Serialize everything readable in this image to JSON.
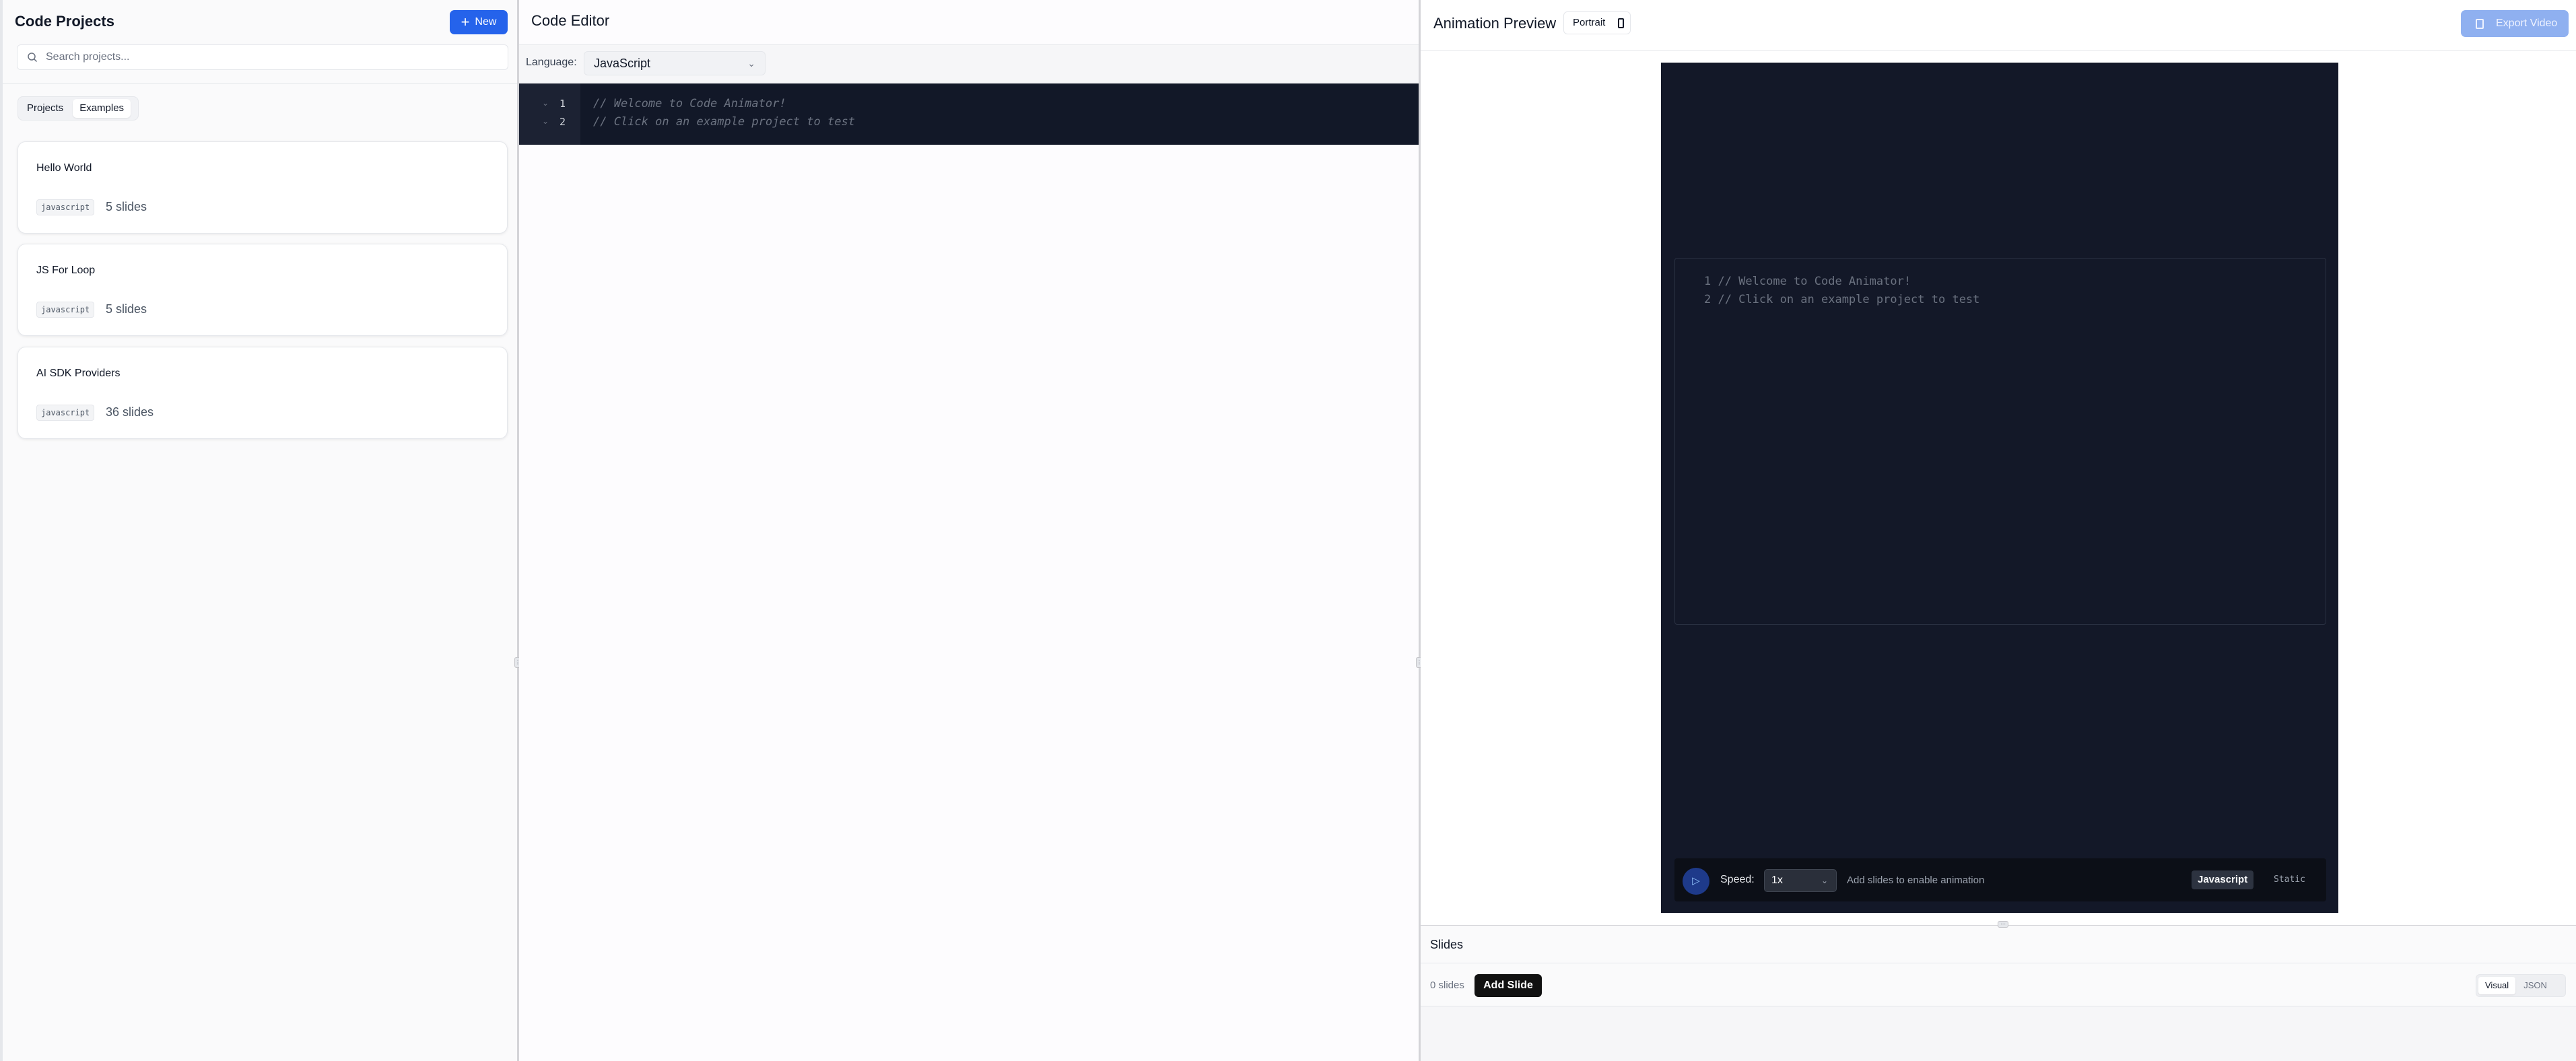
{
  "projects_panel": {
    "title": "Code Projects",
    "new_button": "New",
    "search_placeholder": "Search projects...",
    "tabs": [
      {
        "label": "Projects",
        "active": false
      },
      {
        "label": "Examples",
        "active": true
      }
    ],
    "cards": [
      {
        "name": "Hello World",
        "language": "javascript",
        "slides": "5 slides"
      },
      {
        "name": "JS For Loop",
        "language": "javascript",
        "slides": "5 slides"
      },
      {
        "name": "AI SDK Providers",
        "language": "javascript",
        "slides": "36 slides"
      }
    ]
  },
  "editor": {
    "title": "Code Editor",
    "language_label": "Language:",
    "language_value": "JavaScript",
    "lines": [
      {
        "num": "1",
        "text": "// Welcome to Code Animator!"
      },
      {
        "num": "2",
        "text": "// Click on an example project to test"
      }
    ]
  },
  "preview": {
    "title": "Animation Preview",
    "orientation": "Portrait",
    "export_button": "Export Video",
    "code_lines": [
      "1 // Welcome to Code Animator!",
      "2 // Click on an example project to test"
    ],
    "speed_label": "Speed:",
    "speed_value": "1x",
    "hint": "Add slides to enable animation",
    "language_badge": "Javascript",
    "mode_label": "Static"
  },
  "slides": {
    "title": "Slides",
    "count": "0 slides",
    "add_button": "Add Slide",
    "views": [
      {
        "label": "Visual",
        "active": true
      },
      {
        "label": "JSON",
        "active": false
      }
    ]
  },
  "colors": {
    "primary": "#2563eb",
    "code_bg": "#121828",
    "export_disabled": "#8fb0f0"
  }
}
